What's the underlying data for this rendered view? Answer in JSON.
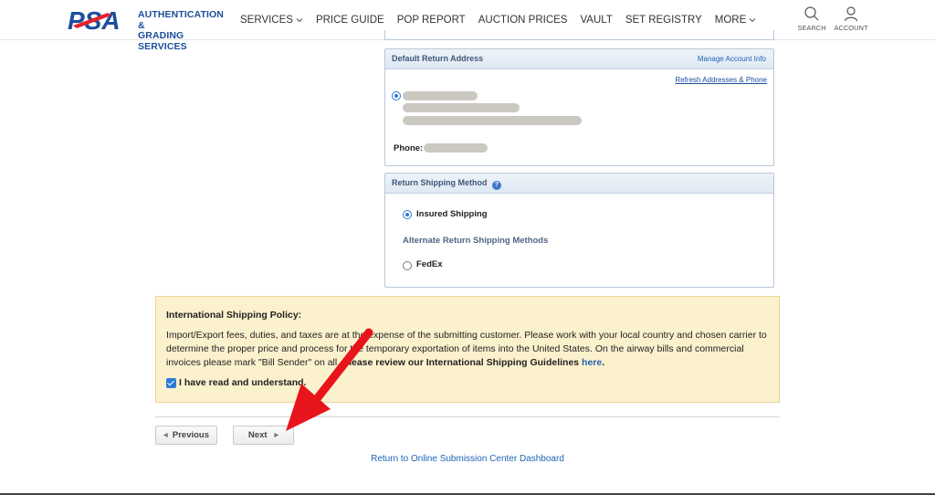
{
  "header": {
    "logo_text_line1": "AUTHENTICATION &",
    "logo_text_line2": "GRADING SERVICES",
    "nav": [
      {
        "label": "SERVICES",
        "has_chevron": true
      },
      {
        "label": "PRICE GUIDE"
      },
      {
        "label": "POP REPORT"
      },
      {
        "label": "AUCTION PRICES"
      },
      {
        "label": "VAULT"
      },
      {
        "label": "SET REGISTRY"
      },
      {
        "label": "MORE",
        "has_chevron": true
      }
    ],
    "search_label": "SEARCH",
    "account_label": "ACCOUNT"
  },
  "address_panel": {
    "title": "Default Return Address",
    "manage_link": "Manage Account Info",
    "refresh_link": "Refresh Addresses & Phone",
    "phone_label": "Phone:"
  },
  "shipping_panel": {
    "title": "Return Shipping Method",
    "help_icon": "question-icon",
    "insured_label": "Insured Shipping",
    "alternate_heading": "Alternate Return Shipping Methods",
    "fedex_label": "FedEx"
  },
  "policy": {
    "title": "International Shipping Policy:",
    "body": "Import/Export fees, duties, and taxes are at the expense of the submitting customer. Please work with your local country and chosen carrier to determine the proper price and process for the temporary exportation of items into the United States. On the airway bills and commercial invoices please mark \"Bill Sender\" on all.",
    "review_text": "Please review our International Shipping Guidelines",
    "here_link": "here",
    "period": ".",
    "ack_label": "I have read and understand."
  },
  "buttons": {
    "previous": "Previous",
    "next": "Next"
  },
  "return_link": "Return to Online Submission Center Dashboard",
  "colors": {
    "brand_blue": "#1b4f9c",
    "brand_red": "#e2232a",
    "link_blue": "#1f63b5",
    "policy_bg": "#fcf1cd",
    "annotation_red": "#e8141c"
  }
}
